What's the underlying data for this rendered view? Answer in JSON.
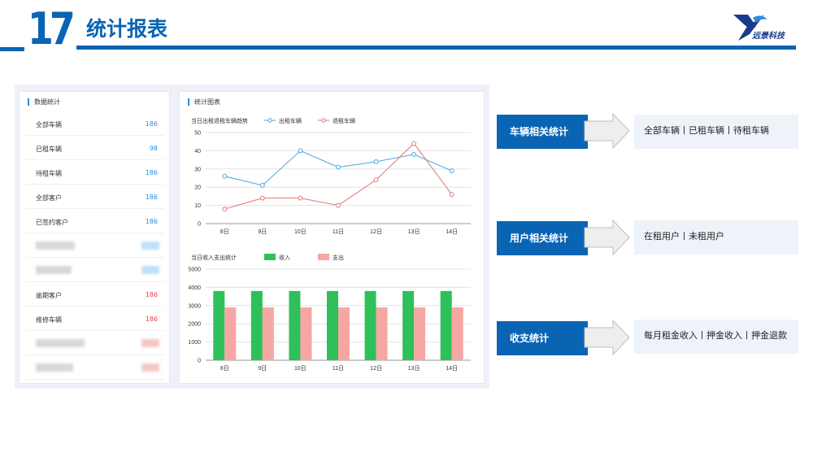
{
  "header": {
    "number": "17",
    "title": "统计报表",
    "logo_text": "远景科技"
  },
  "stats_panel": {
    "title": "数据统计",
    "rows": [
      {
        "label": "全部车辆",
        "value": "186",
        "color": "#2d8ae0"
      },
      {
        "label": "已租车辆",
        "value": "98",
        "color": "#2d8ae0"
      },
      {
        "label": "待租车辆",
        "value": "186",
        "color": "#2d8ae0"
      },
      {
        "label": "全部客户",
        "value": "186",
        "color": "#2d8ae0"
      },
      {
        "label": "已签约客户",
        "value": "186",
        "color": "#2d8ae0"
      },
      {
        "label": "",
        "value": "",
        "color": "#bfe0f8",
        "blurred": true
      },
      {
        "label": "",
        "value": "",
        "color": "#bfe0f8",
        "blurred": true
      },
      {
        "label": "逾期客户",
        "value": "186",
        "color": "#e04848"
      },
      {
        "label": "维修车辆",
        "value": "186",
        "color": "#e04848"
      },
      {
        "label": "",
        "value": "",
        "color": "#f6c6c6",
        "blurred": true
      },
      {
        "label": "",
        "value": "",
        "color": "#f6c6c6",
        "blurred": true
      }
    ]
  },
  "charts_panel": {
    "title": "统计图表"
  },
  "chart_data": [
    {
      "type": "line",
      "title": "当日出租退租车辆趋势",
      "categories": [
        "8日",
        "9日",
        "10日",
        "11日",
        "12日",
        "13日",
        "14日"
      ],
      "ylim": [
        0,
        50
      ],
      "yticks": [
        0,
        10,
        20,
        30,
        40,
        50
      ],
      "legend_position": "top",
      "grid": true,
      "series": [
        {
          "name": "出租车辆",
          "color": "#4aa3df",
          "values": [
            26,
            21,
            40,
            31,
            34,
            38,
            29
          ]
        },
        {
          "name": "退租车辆",
          "color": "#e57373",
          "values": [
            8,
            14,
            14,
            10,
            24,
            44,
            16
          ]
        }
      ]
    },
    {
      "type": "bar",
      "title": "当日收入支出统计",
      "categories": [
        "8日",
        "9日",
        "10日",
        "11日",
        "12日",
        "13日",
        "14日"
      ],
      "ylim": [
        0,
        5000
      ],
      "yticks": [
        0,
        1000,
        2000,
        3000,
        4000,
        5000
      ],
      "legend_position": "top",
      "grid": true,
      "series": [
        {
          "name": "收入",
          "color": "#2ec05a",
          "values": [
            3800,
            3800,
            3800,
            3800,
            3800,
            3800,
            3800
          ]
        },
        {
          "name": "支出",
          "color": "#f6a7a3",
          "values": [
            2900,
            2900,
            2900,
            2900,
            2900,
            2900,
            2900
          ]
        }
      ]
    }
  ],
  "categories": [
    {
      "label": "车辆相关统计",
      "desc": "全部车辆丨已租车辆丨待租车辆"
    },
    {
      "label": "用户相关统计",
      "desc": "在租用户丨未租用户"
    },
    {
      "label": "收支统计",
      "desc": "每月租金收入丨押金收入丨押金退款"
    }
  ]
}
